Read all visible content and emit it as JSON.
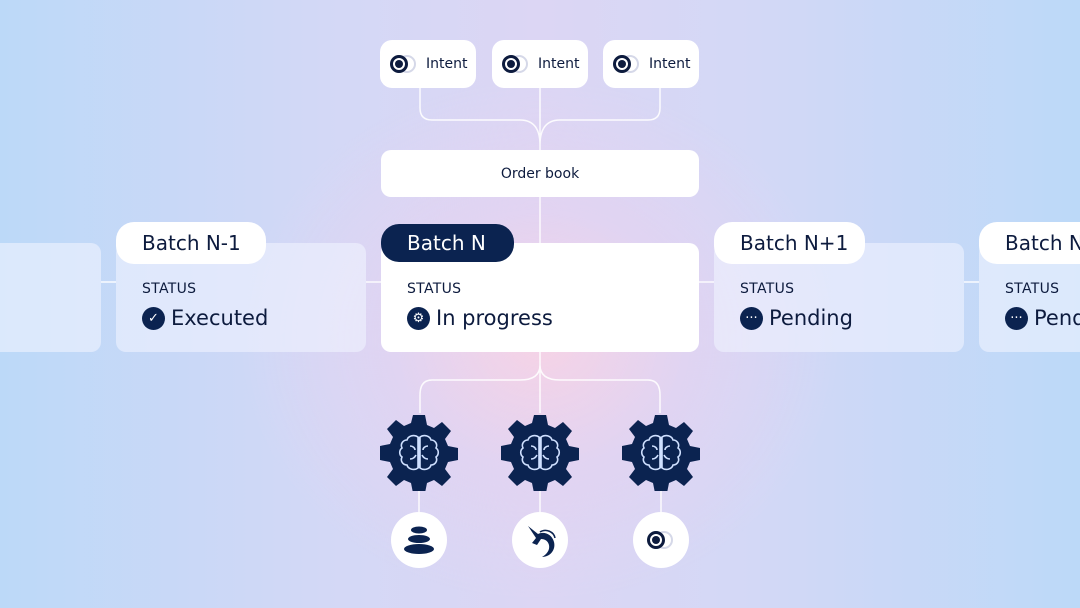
{
  "intents": [
    {
      "label": "Intent"
    },
    {
      "label": "Intent"
    },
    {
      "label": "Intent"
    }
  ],
  "order_book": {
    "label": "Order book"
  },
  "batches": [
    {
      "title": "",
      "status_label": "",
      "status": ""
    },
    {
      "title": "Batch N-1",
      "status_label": "STATUS",
      "status": "Executed",
      "icon": "check-circle-icon"
    },
    {
      "title": "Batch N",
      "status_label": "STATUS",
      "status": "In progress",
      "icon": "gear-icon"
    },
    {
      "title": "Batch N+1",
      "status_label": "STATUS",
      "status": "Pending",
      "icon": "ellipsis-circle-icon"
    },
    {
      "title": "Batch N",
      "status_label": "STATUS",
      "status": "Pending",
      "icon": "ellipsis-circle-icon"
    }
  ],
  "solvers": [
    {
      "icon": "brain-gear-icon",
      "protocol_icon": "stacked-stones-icon"
    },
    {
      "icon": "brain-gear-icon",
      "protocol_icon": "unicorn-icon"
    },
    {
      "icon": "brain-gear-icon",
      "protocol_icon": "toggle-icon"
    }
  ],
  "colors": {
    "navy": "#0b2350",
    "card": "#ffffff",
    "bg_blue": "#bcd9f8",
    "bg_pink": "#f6d3e6"
  }
}
